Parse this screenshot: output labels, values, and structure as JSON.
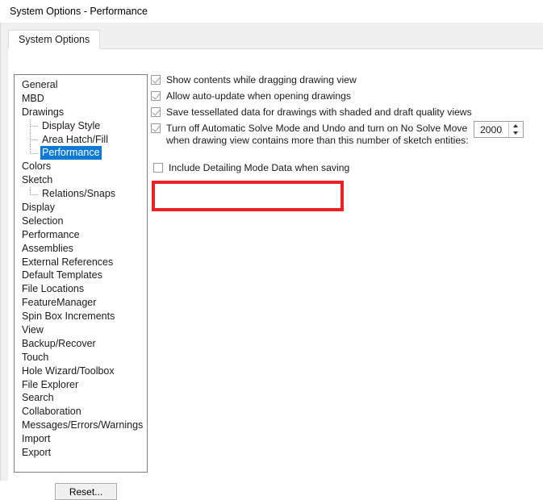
{
  "window": {
    "title": "System Options - Performance"
  },
  "tabs": [
    {
      "label": "System Options",
      "active": true
    }
  ],
  "sidebar": {
    "items": [
      {
        "label": "General",
        "level": 0,
        "selected": false
      },
      {
        "label": "MBD",
        "level": 0,
        "selected": false
      },
      {
        "label": "Drawings",
        "level": 0,
        "selected": false
      },
      {
        "label": "Display Style",
        "level": 1,
        "selected": false
      },
      {
        "label": "Area Hatch/Fill",
        "level": 1,
        "selected": false
      },
      {
        "label": "Performance",
        "level": 1,
        "selected": true
      },
      {
        "label": "Colors",
        "level": 0,
        "selected": false
      },
      {
        "label": "Sketch",
        "level": 0,
        "selected": false
      },
      {
        "label": "Relations/Snaps",
        "level": 1,
        "selected": false
      },
      {
        "label": "Display",
        "level": 0,
        "selected": false
      },
      {
        "label": "Selection",
        "level": 0,
        "selected": false
      },
      {
        "label": "Performance",
        "level": 0,
        "selected": false
      },
      {
        "label": "Assemblies",
        "level": 0,
        "selected": false
      },
      {
        "label": "External References",
        "level": 0,
        "selected": false
      },
      {
        "label": "Default Templates",
        "level": 0,
        "selected": false
      },
      {
        "label": "File Locations",
        "level": 0,
        "selected": false
      },
      {
        "label": "FeatureManager",
        "level": 0,
        "selected": false
      },
      {
        "label": "Spin Box Increments",
        "level": 0,
        "selected": false
      },
      {
        "label": "View",
        "level": 0,
        "selected": false
      },
      {
        "label": "Backup/Recover",
        "level": 0,
        "selected": false
      },
      {
        "label": "Touch",
        "level": 0,
        "selected": false
      },
      {
        "label": "Hole Wizard/Toolbox",
        "level": 0,
        "selected": false
      },
      {
        "label": "File Explorer",
        "level": 0,
        "selected": false
      },
      {
        "label": "Search",
        "level": 0,
        "selected": false
      },
      {
        "label": "Collaboration",
        "level": 0,
        "selected": false
      },
      {
        "label": "Messages/Errors/Warnings",
        "level": 0,
        "selected": false
      },
      {
        "label": "Import",
        "level": 0,
        "selected": false
      },
      {
        "label": "Export",
        "level": 0,
        "selected": false
      }
    ]
  },
  "buttons": {
    "reset": "Reset..."
  },
  "options": [
    {
      "id": "show-contents-while-dragging",
      "label": "Show contents while dragging drawing view",
      "checked": true
    },
    {
      "id": "allow-auto-update",
      "label": "Allow auto-update when opening drawings",
      "checked": true
    },
    {
      "id": "save-tessellated-data",
      "label": "Save tessellated data for drawings with shaded and draft quality views",
      "checked": true
    },
    {
      "id": "turn-off-automatic-solve-mode",
      "label": "Turn off Automatic Solve Mode and Undo and turn on No Solve Move",
      "label_line2": "when drawing view contains more than this number of sketch entities:",
      "checked": true
    },
    {
      "id": "include-detailing-mode-data",
      "label": "Include Detailing Mode Data when saving",
      "checked": false
    }
  ],
  "spinner": {
    "value": "2000",
    "up_icon": "triangle-up-icon",
    "down_icon": "triangle-down-icon"
  },
  "annotation": {
    "color": "#ee2024",
    "target": "include-detailing-mode-data"
  },
  "colors": {
    "selection_blue": "#0b7ad6",
    "annotation_red": "#ee2024",
    "window_chrome": "#f0f0f0"
  }
}
